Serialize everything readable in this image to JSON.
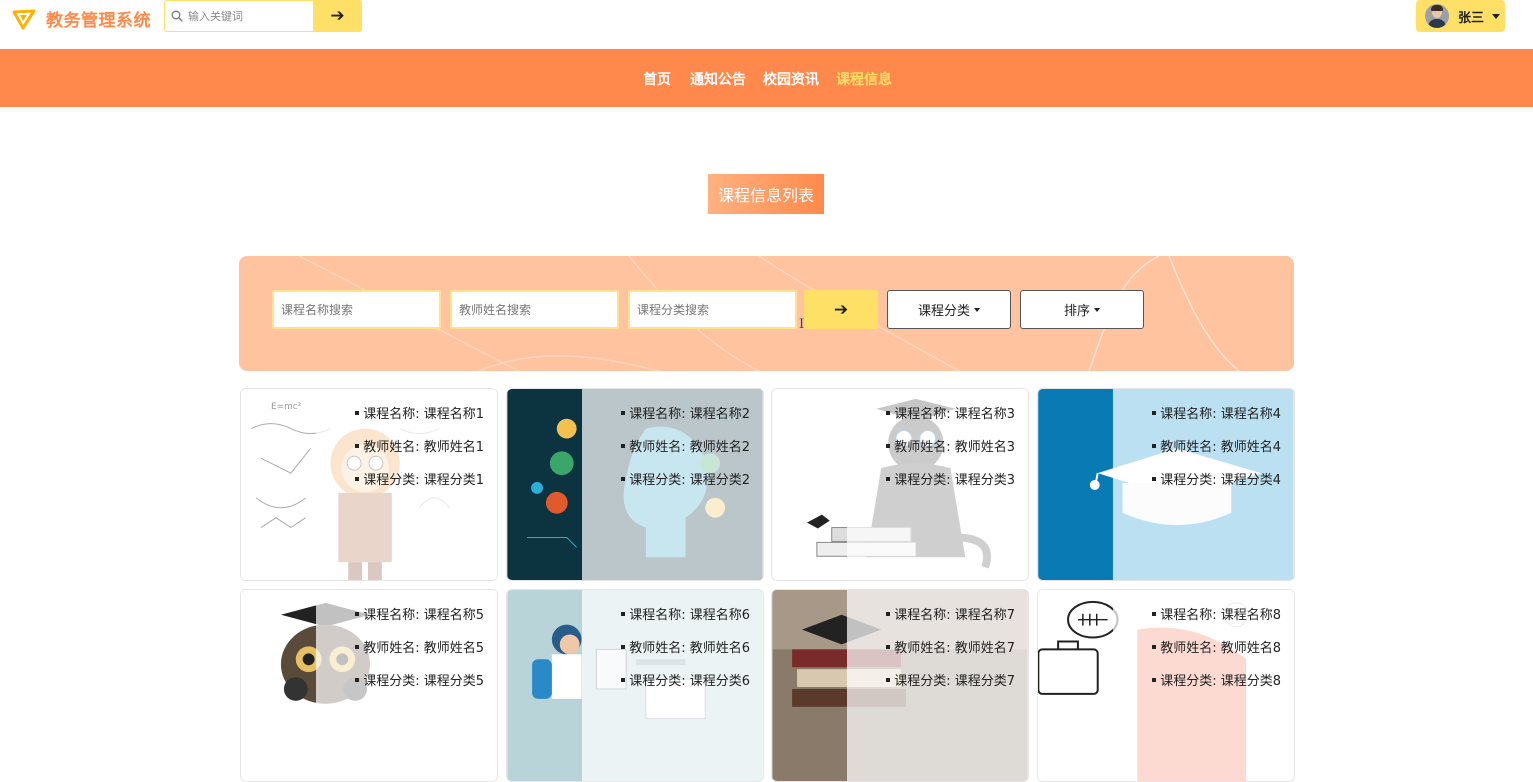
{
  "header": {
    "app_title": "教务管理系统",
    "search_placeholder": "输入关键词",
    "search_button_glyph": "➔",
    "user_name": "张三"
  },
  "nav": {
    "items": [
      {
        "label": "首页",
        "active": false
      },
      {
        "label": "通知公告",
        "active": false
      },
      {
        "label": "校园资讯",
        "active": false
      },
      {
        "label": "课程信息",
        "active": true
      }
    ]
  },
  "page_title": "课程信息列表",
  "search": {
    "course_name_placeholder": "课程名称搜索",
    "teacher_name_placeholder": "教师姓名搜索",
    "category_placeholder": "课程分类搜索",
    "go_glyph": "➔",
    "category_dropdown": "课程分类",
    "sort_dropdown": "排序"
  },
  "courses": [
    {
      "name_label": "课程名称: 课程名称1",
      "teacher_label": "教师姓名: 教师姓名1",
      "category_label": "课程分类: 课程分类1",
      "art": "scientist-sketch"
    },
    {
      "name_label": "课程名称: 课程名称2",
      "teacher_label": "教师姓名: 教师姓名2",
      "category_label": "课程分类: 课程分类2",
      "art": "tech-brain"
    },
    {
      "name_label": "课程名称: 课程名称3",
      "teacher_label": "教师姓名: 教师姓名3",
      "category_label": "课程分类: 课程分类3",
      "art": "cat-graduate"
    },
    {
      "name_label": "课程名称: 课程名称4",
      "teacher_label": "教师姓名: 教师姓名4",
      "category_label": "课程分类: 课程分类4",
      "art": "graduation-cap-blue"
    },
    {
      "name_label": "课程名称: 课程名称5",
      "teacher_label": "教师姓名: 教师姓名5",
      "category_label": "课程分类: 课程分类5",
      "art": "owl-graduate"
    },
    {
      "name_label": "课程名称: 课程名称6",
      "teacher_label": "教师姓名: 教师姓名6",
      "category_label": "课程分类: 课程分类6",
      "art": "lab-scientist"
    },
    {
      "name_label": "课程名称: 课程名称7",
      "teacher_label": "教师姓名: 教师姓名7",
      "category_label": "课程分类: 课程分类7",
      "art": "books-cap"
    },
    {
      "name_label": "课程名称: 课程名称8",
      "teacher_label": "教师姓名: 教师姓名8",
      "category_label": "课程分类: 课程分类8",
      "art": "briefcase-sketch"
    }
  ],
  "colors": {
    "brand": "#ff884d",
    "accent_yellow": "#ffe066",
    "panel": "#ffc3a0"
  }
}
